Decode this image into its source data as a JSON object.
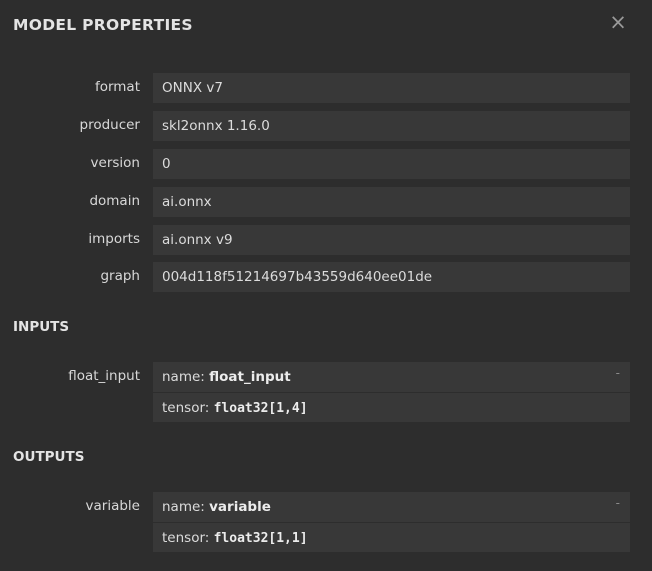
{
  "header": {
    "title": "MODEL PROPERTIES",
    "close_icon": "×"
  },
  "properties": [
    {
      "label": "format",
      "value": "ONNX v7"
    },
    {
      "label": "producer",
      "value": "skl2onnx 1.16.0"
    },
    {
      "label": "version",
      "value": "0"
    },
    {
      "label": "domain",
      "value": "ai.onnx"
    },
    {
      "label": "imports",
      "value": "ai.onnx v9"
    },
    {
      "label": "graph",
      "value": "004d118f51214697b43559d640ee01de"
    }
  ],
  "inputs": {
    "heading": "INPUTS",
    "items": [
      {
        "label": "float_input",
        "name_prefix": "name: ",
        "name": "float_input",
        "tensor_prefix": "tensor: ",
        "tensor": "float32[1,4]",
        "expander": "-"
      }
    ]
  },
  "outputs": {
    "heading": "OUTPUTS",
    "items": [
      {
        "label": "variable",
        "name_prefix": "name: ",
        "name": "variable",
        "tensor_prefix": "tensor: ",
        "tensor": "float32[1,1]",
        "expander": "-"
      }
    ]
  },
  "colors": {
    "background": "#2d2d2d",
    "value_box": "#383838",
    "text": "#dcdcdc"
  }
}
